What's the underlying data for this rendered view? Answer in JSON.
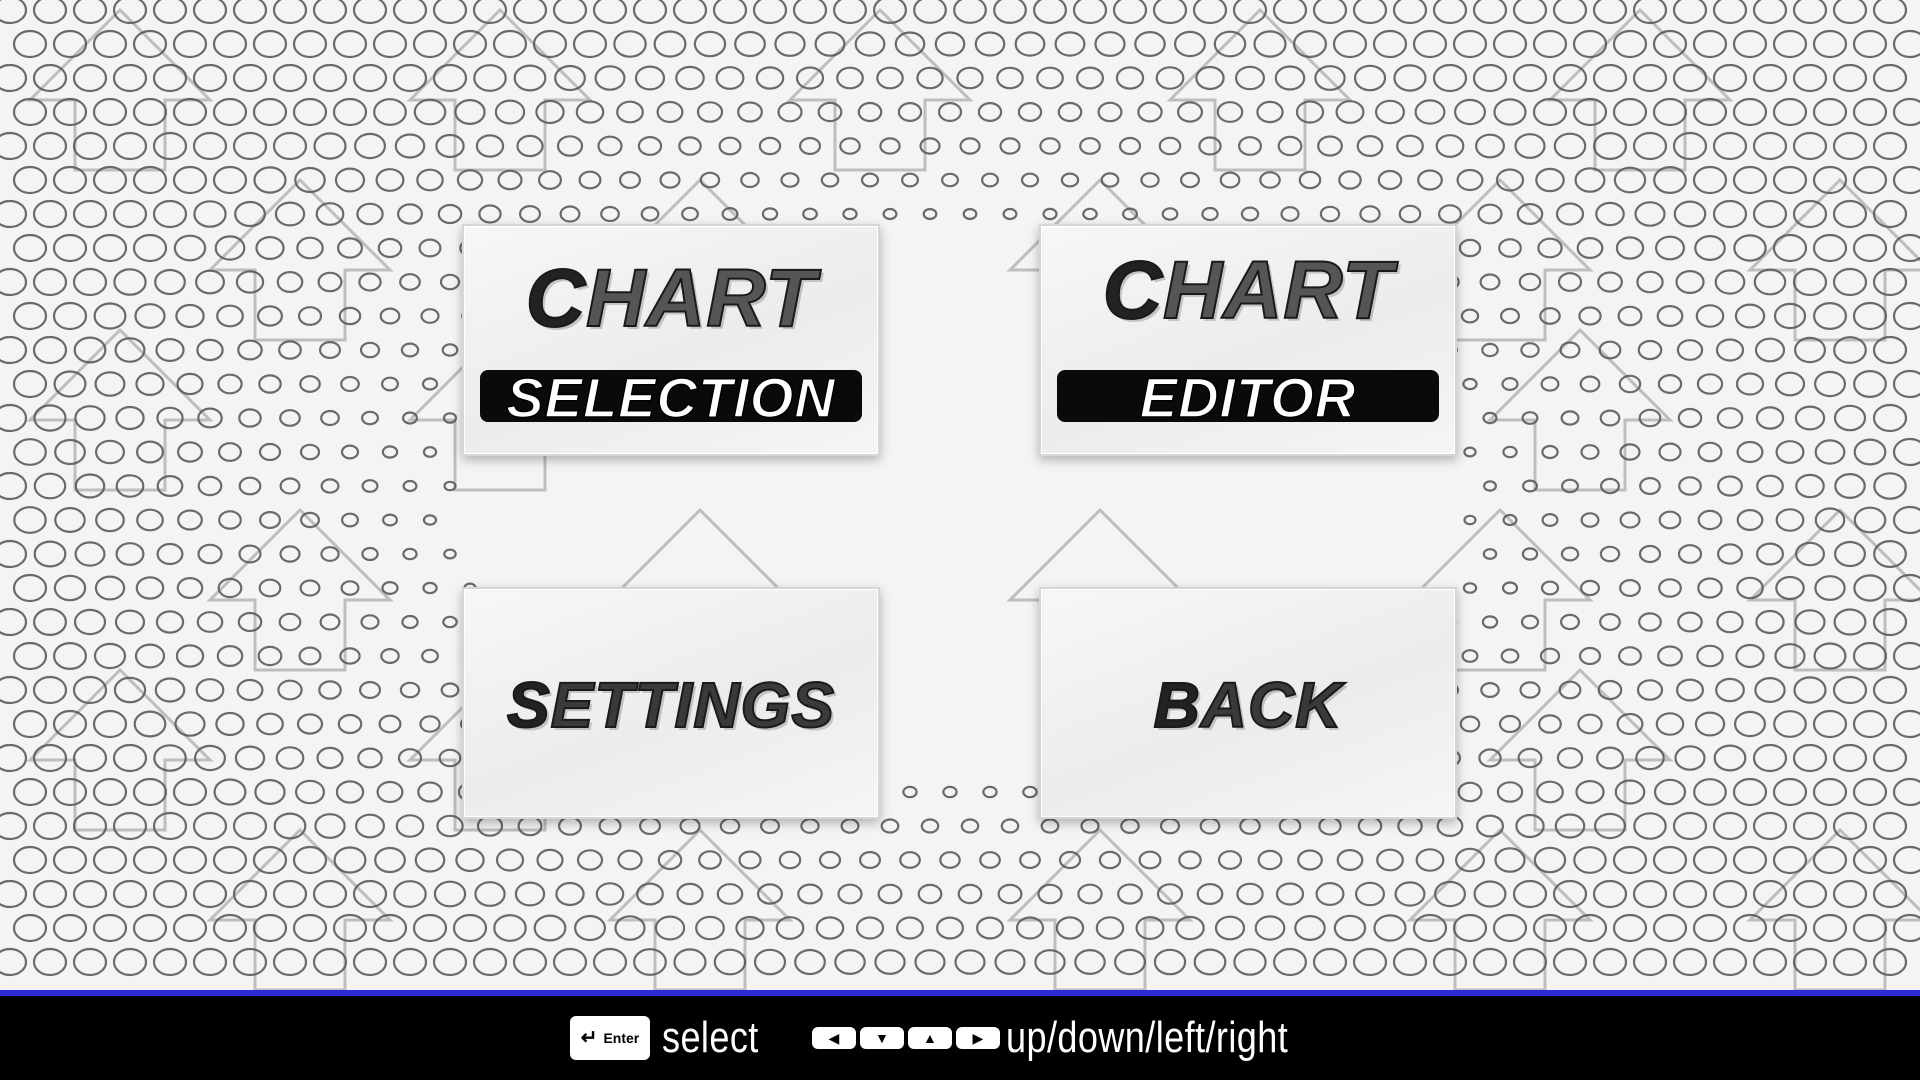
{
  "menu": {
    "chart_selection": {
      "word1": "CHART",
      "word2": "SELECTION"
    },
    "chart_editor": {
      "word1": "CHART",
      "word2": "EDITOR"
    },
    "settings": {
      "label": "SETTINGS"
    },
    "back": {
      "label": "BACK"
    }
  },
  "footer": {
    "accent_color": "#2b2bd1",
    "enter_key": {
      "icon": "enter-arrow-icon",
      "glyph": "↵",
      "label": "Enter"
    },
    "select_label": "select",
    "arrow_keys": [
      {
        "icon": "arrow-left-icon",
        "glyph": "◀"
      },
      {
        "icon": "arrow-down-icon",
        "glyph": "▼"
      },
      {
        "icon": "arrow-up-icon",
        "glyph": "▲"
      },
      {
        "icon": "arrow-right-icon",
        "glyph": "▶"
      }
    ],
    "move_label": "up/down/left/right"
  }
}
